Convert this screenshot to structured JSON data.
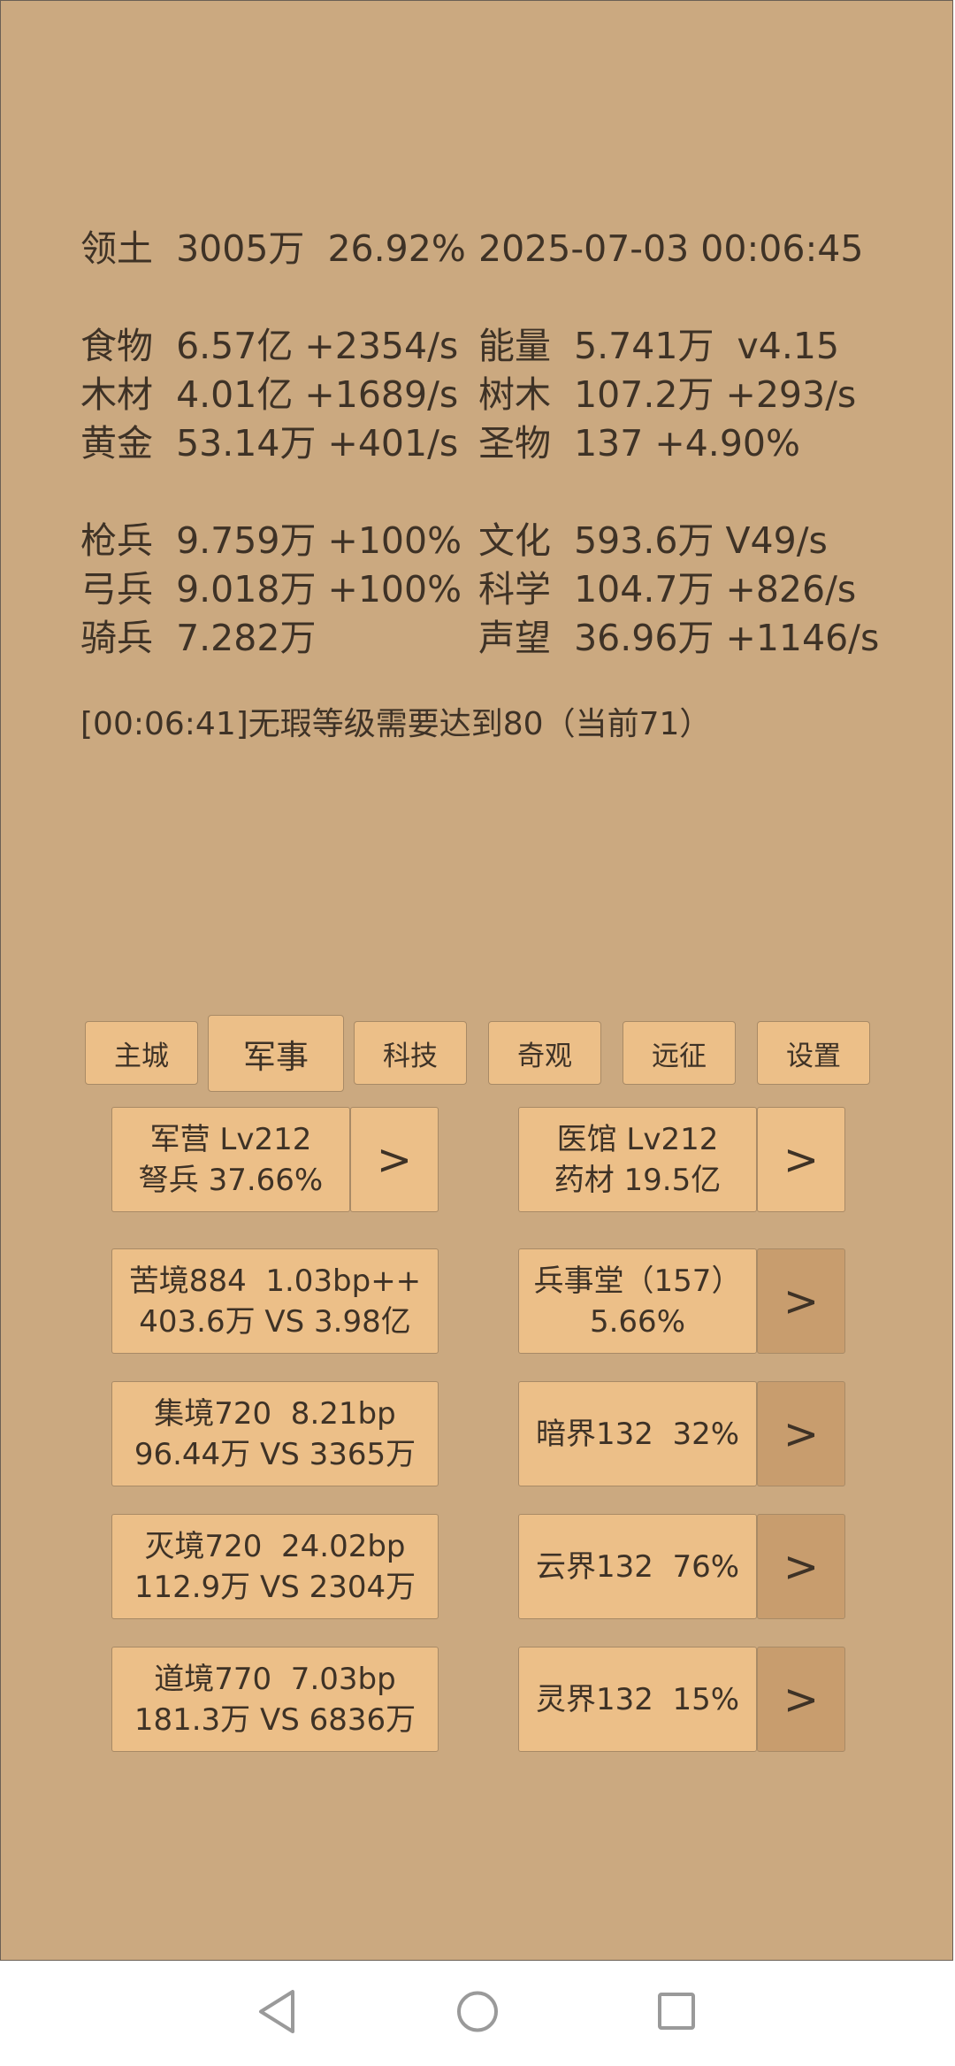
{
  "stats": {
    "territory": "领土  3005万  26.92%",
    "datetime": "2025-07-03 00:06:45",
    "food": "食物  6.57亿 +2354/s",
    "energy": "能量  5.741万  v4.15",
    "wood": "木材  4.01亿 +1689/s",
    "trees": "树木  107.2万 +293/s",
    "gold": "黄金  53.14万 +401/s",
    "relics": "圣物  137 +4.90%",
    "spearmen": "枪兵  9.759万 +100%",
    "culture": "文化  593.6万 V49/s",
    "archers": "弓兵  9.018万 +100%",
    "science": "科学  104.7万 +826/s",
    "cavalry": "骑兵  7.282万",
    "prestige": "声望  36.96万 +1146/s"
  },
  "log": "[00:06:41]无瑕等级需要达到80（当前71）",
  "tabs": [
    "主城",
    "军事",
    "科技",
    "奇观",
    "远征",
    "设置"
  ],
  "active_tab": "军事",
  "cards": {
    "barracks": {
      "line1": "军营 Lv212",
      "line2": "弩兵 37.66%"
    },
    "clinic": {
      "line1": "医馆 Lv212",
      "line2": "药材 19.5亿"
    },
    "ku": {
      "line1": "苦境884  1.03bp++",
      "line2": "403.6万 VS 3.98亿"
    },
    "bingshitang": {
      "line1": "兵事堂（157）",
      "line2": "5.66%"
    },
    "ji": {
      "line1": "集境720  8.21bp",
      "line2": "96.44万 VS 3365万"
    },
    "anjie": {
      "line1": "暗界132  32%"
    },
    "mie": {
      "line1": "灭境720  24.02bp",
      "line2": "112.9万 VS 2304万"
    },
    "yunjie": {
      "line1": "云界132  76%"
    },
    "dao": {
      "line1": "道境770  7.03bp",
      "line2": "181.3万 VS 6836万"
    },
    "lingjie": {
      "line1": "灵界132  15%"
    }
  },
  "arrow_label": ">",
  "nav": {
    "back_icon": "back-triangle-icon",
    "home_icon": "home-circle-icon",
    "recents_icon": "recents-square-icon"
  }
}
